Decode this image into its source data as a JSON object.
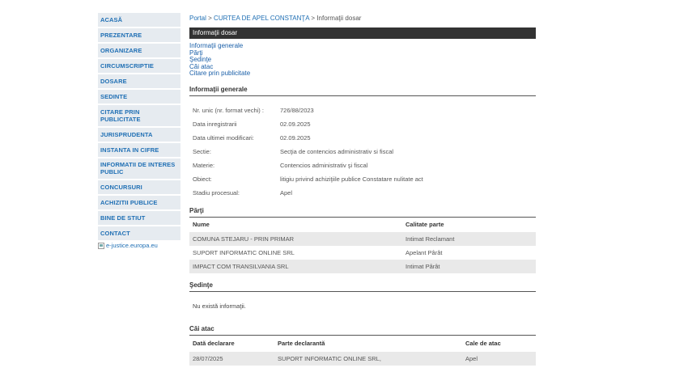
{
  "sidebar": {
    "items": [
      {
        "label": "ACASĂ"
      },
      {
        "label": "PREZENTARE"
      },
      {
        "label": "ORGANIZARE"
      },
      {
        "label": "CIRCUMSCRIPTIE"
      },
      {
        "label": "DOSARE"
      },
      {
        "label": "SEDINTE"
      },
      {
        "label": "CITARE PRIN PUBLICITATE"
      },
      {
        "label": "JURISPRUDENTA"
      },
      {
        "label": "INSTANTA IN CIFRE"
      },
      {
        "label": "INFORMATII DE INTERES PUBLIC"
      },
      {
        "label": "CONCURSURI"
      },
      {
        "label": "ACHIZITII PUBLICE"
      },
      {
        "label": "BINE DE STIUT"
      },
      {
        "label": "CONTACT"
      }
    ],
    "ejustice_alt": "e-justice.europa.eu"
  },
  "breadcrumb": {
    "portal": "Portal",
    "sep1": ">",
    "court": "CURTEA DE APEL CONSTANŢA",
    "sep2": ">",
    "current": "Informaţii dosar"
  },
  "title_bar": "Informaţii dosar",
  "anchor_links": [
    "Informaţii generale",
    "Părţi",
    "Şedinţe",
    "Căi atac",
    "Citare prin publicitate"
  ],
  "general": {
    "title": "Informaţii generale",
    "rows": [
      {
        "label": "Nr. unic (nr. format vechi) :",
        "value": "726/88/2023"
      },
      {
        "label": "Data inregistrarii",
        "value": "02.09.2025"
      },
      {
        "label": "Data ultimei modificari:",
        "value": "02.09.2025"
      },
      {
        "label": "Sectie:",
        "value": "Secţia de contencios administrativ si fiscal"
      },
      {
        "label": "Materie:",
        "value": "Contencios administrativ şi fiscal"
      },
      {
        "label": "Obiect:",
        "value": "litigiu privind achiziţiile publice Constatare nulitate act"
      },
      {
        "label": "Stadiu procesual:",
        "value": "Apel"
      }
    ]
  },
  "parti": {
    "title": "Părţi",
    "headers": [
      "Nume",
      "Calitate parte"
    ],
    "rows": [
      {
        "name": "COMUNA STEJARU - PRIN PRIMAR",
        "role": "Intimat Reclamant"
      },
      {
        "name": "SUPORT INFORMATIC ONLINE SRL",
        "role": "Apelant Pârât"
      },
      {
        "name": "IMPACT COM TRANSILVANIA SRL",
        "role": "Intimat Pârât"
      }
    ]
  },
  "sedinte": {
    "title": "Şedinţe",
    "empty": "Nu există informaţii."
  },
  "cai_atac": {
    "title": "Căi atac",
    "headers": [
      "Dată declarare",
      "Parte declarantă",
      "Cale de atac"
    ],
    "rows": [
      {
        "date": "28/07/2025",
        "party": "SUPORT INFORMATIC ONLINE SRL,",
        "type": "Apel"
      }
    ]
  }
}
